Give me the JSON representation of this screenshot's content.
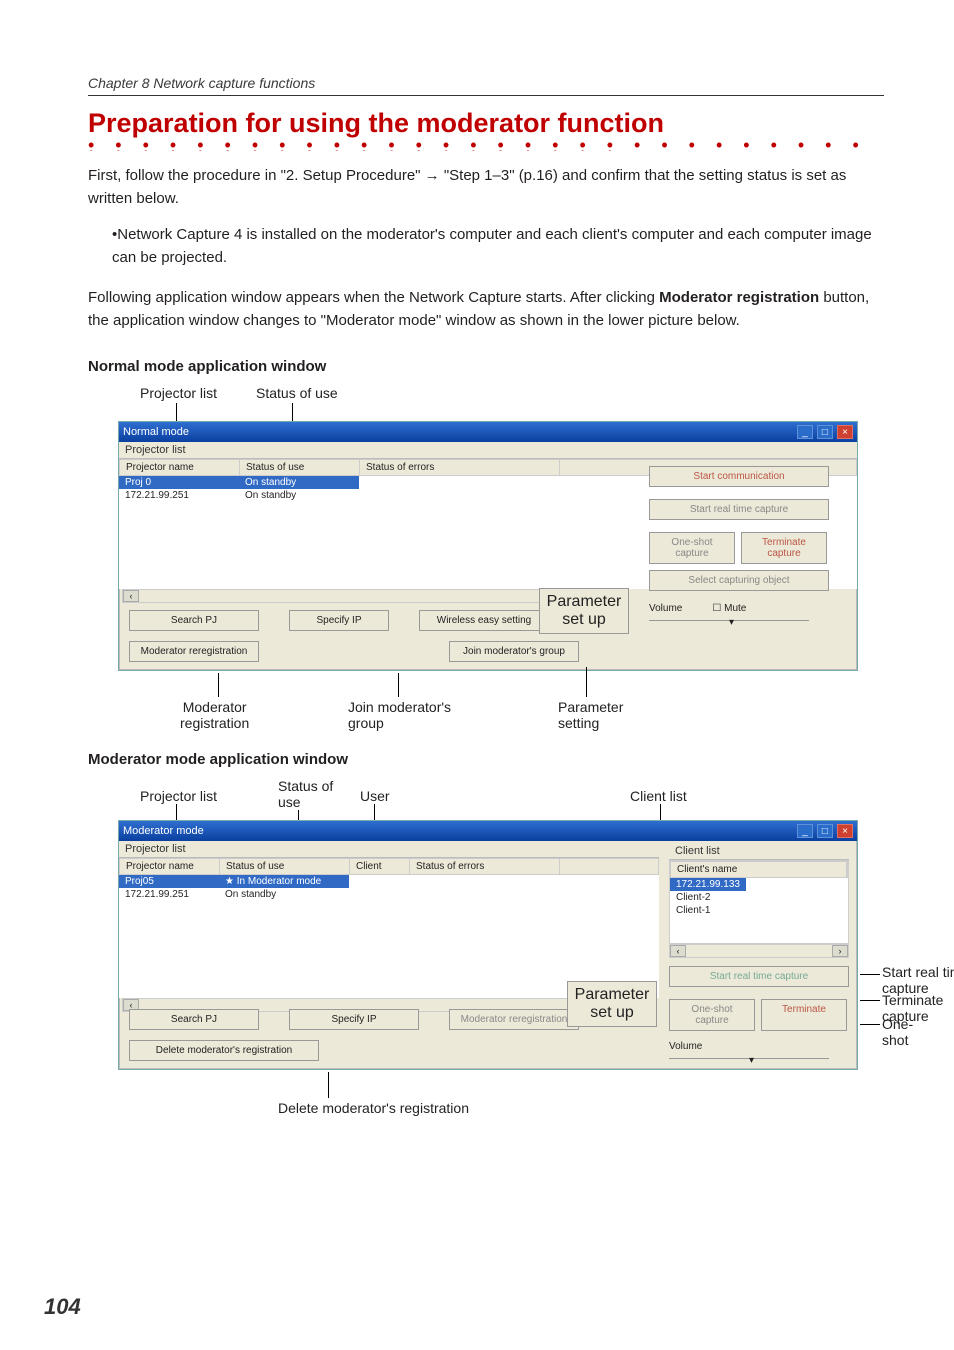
{
  "chapter_line": "Chapter 8 Network capture functions",
  "main_title": "Preparation for using the moderator function",
  "para1a": "First, follow the procedure in \"2. Setup Procedure\" ",
  "para1_arrow": "→",
  "para1b": " \"Step 1–3\" (p.16) and confirm that the setting status is set as written below.",
  "bullet1": "•Network Capture 4 is installed on the moderator's computer and each client's computer and each computer image can be projected.",
  "para2a": "Following application window appears when the Network Capture starts. After clicking ",
  "para2_bold": "Moderator registration",
  "para2b": " button, the application window changes to \"Moderator mode\" window as shown in the lower picture below.",
  "sub_normal": "Normal mode application window",
  "sub_moderator": "Moderator mode application window",
  "label_projector_list": "Projector list",
  "label_status_of_use": "Status of use",
  "label_user": "User",
  "label_client_list": "Client list",
  "callout_moderator_reg": "Moderator\nregistration",
  "callout_join_group": "Join moderator's\ngroup",
  "callout_param_setting": "Parameter\nsetting",
  "callout_start_rtc": "Start real time\ncapture",
  "callout_terminate": "Terminate capture",
  "callout_oneshot": "One-shot",
  "callout_delete_reg": "Delete moderator's registration",
  "win_normal": {
    "title": "Normal mode",
    "projector_list_label": "Projector list",
    "head_projector": "Projector name",
    "head_status": "Status of use",
    "head_errors": "Status of errors",
    "rows": [
      {
        "name": "Proj 0",
        "status": "On standby",
        "selected": true
      },
      {
        "name": "172.21.99.251",
        "status": "On standby",
        "selected": false
      }
    ],
    "btn_start_comm": "Start communication",
    "btn_start_rtc": "Start real time capture",
    "btn_oneshot": "One-shot capture",
    "btn_terminate": "Terminate capture",
    "btn_select_obj": "Select capturing object",
    "btn_search": "Search PJ",
    "btn_specify": "Specify IP",
    "btn_wireless": "Wireless easy setting",
    "btn_modreg": "Moderator reregistration",
    "btn_joingrp": "Join moderator's group",
    "btn_param": "Parameter set up",
    "volume_label": "Volume",
    "mute_label": "Mute"
  },
  "win_mod": {
    "title": "Moderator mode",
    "projector_list_label": "Projector list",
    "head_projector": "Projector name",
    "head_status": "Status of use",
    "head_client": "Client",
    "head_errors": "Status of errors",
    "rows": [
      {
        "name": "Proj05",
        "status": "★ In Moderator mode",
        "selected": true
      },
      {
        "name": "172.21.99.251",
        "status": "On standby",
        "selected": false
      }
    ],
    "clientlist_label": "Client list",
    "client_head": "Client's name",
    "clients": [
      "172.21.99.133",
      "Client-2",
      "Client-1"
    ],
    "btn_start_rtc": "Start real time capture",
    "btn_oneshot": "One-shot capture",
    "btn_terminate": "Terminate",
    "btn_search": "Search PJ",
    "btn_specify": "Specify IP",
    "btn_modreg": "Moderator reregistration",
    "btn_delreg": "Delete moderator's registration",
    "btn_param": "Parameter set up",
    "volume_label": "Volume"
  },
  "page_number": "104"
}
